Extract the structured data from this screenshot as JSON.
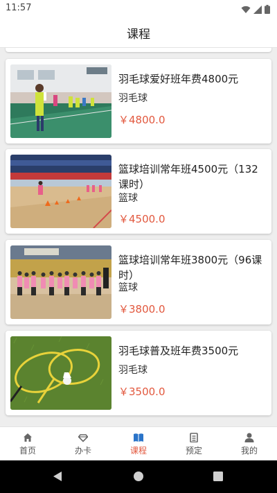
{
  "status_bar": {
    "time": "11:57"
  },
  "header": {
    "title": "课程"
  },
  "courses": [
    {
      "title": "羽毛球爱好班年费4800元",
      "category": "羽毛球",
      "price": "￥4800.0"
    },
    {
      "title": "篮球培训常年班4500元（132课时）",
      "category": "篮球",
      "price": "￥4500.0"
    },
    {
      "title": "篮球培训常年班3800元（96课时）",
      "category": "篮球",
      "price": "￥3800.0"
    },
    {
      "title": "羽毛球普及班年费3500元",
      "category": "羽毛球",
      "price": "￥3500.0"
    }
  ],
  "bottom_nav": {
    "items": [
      {
        "label": "首页",
        "icon": "home-icon"
      },
      {
        "label": "办卡",
        "icon": "diamond-icon"
      },
      {
        "label": "课程",
        "icon": "book-icon"
      },
      {
        "label": "预定",
        "icon": "clipboard-icon"
      },
      {
        "label": "我的",
        "icon": "person-icon"
      }
    ],
    "active_index": 2
  },
  "colors": {
    "accent": "#e2583e",
    "active_tab": "#e2583e",
    "icon_grey": "#666666"
  }
}
